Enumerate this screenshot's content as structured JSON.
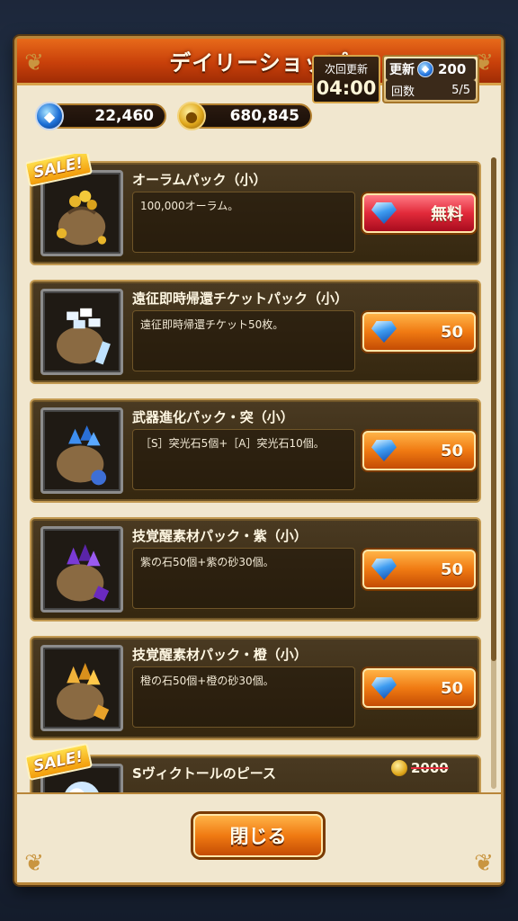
{
  "header": {
    "title": "デイリーショップ"
  },
  "currency": {
    "gems": "22,460",
    "gold": "680,845"
  },
  "refresh": {
    "timer_label": "次回更新",
    "timer_value": "04:00",
    "label": "更新",
    "cost": "200",
    "count_label": "回数",
    "count_value": "5/5"
  },
  "items": [
    {
      "name": "オーラムパック（小）",
      "description": "100,000オーラム。",
      "price": "無料",
      "sale_label": "SALE!",
      "icon": "gold-coin-bag-icon"
    },
    {
      "name": "遠征即時帰還チケットパック（小）",
      "description": "遠征即時帰還チケット50枚。",
      "price": "50",
      "icon": "ticket-bag-icon"
    },
    {
      "name": "武器進化パック・突（小）",
      "description": "［S］突光石5個+［A］突光石10個。",
      "price": "50",
      "icon": "blue-crystal-bag-icon"
    },
    {
      "name": "技覚醒素材パック・紫（小）",
      "description": "紫の石50個+紫の砂30個。",
      "price": "50",
      "icon": "purple-crystal-bag-icon"
    },
    {
      "name": "技覚醒素材パック・橙（小）",
      "description": "橙の石50個+橙の砂30個。",
      "price": "50",
      "icon": "orange-crystal-bag-icon"
    },
    {
      "name": "Sヴィクトールのピース",
      "original_price": "2000",
      "sale_label": "SALE!",
      "icon": "character-piece-icon"
    }
  ],
  "footer": {
    "close_label": "閉じる"
  },
  "colors": {
    "accent": "#e86a1a",
    "panel": "#f1e7cf",
    "card": "#3d2e18",
    "free_button": "#e22a3a"
  }
}
